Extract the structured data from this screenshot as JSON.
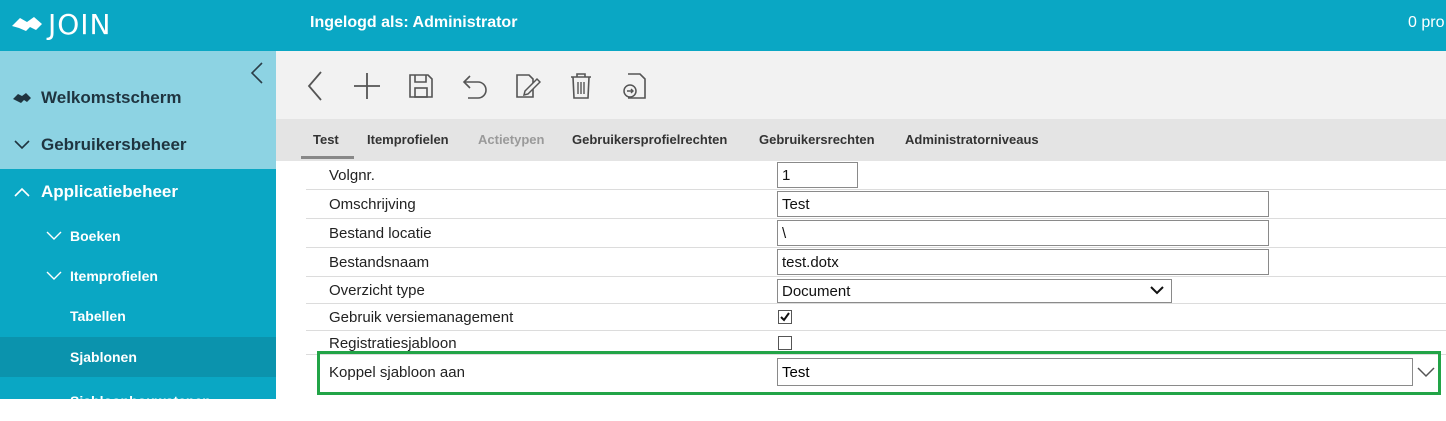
{
  "app": {
    "logo_text": "JOIN",
    "login_text": "Ingelogd als: Administrator",
    "top_right_text": "0 pro"
  },
  "sidebar": {
    "items": [
      {
        "label": "Welkomstscherm",
        "icon": "handshake-icon"
      },
      {
        "label": "Gebruikersbeheer",
        "icon": "chevron-down-icon"
      },
      {
        "label": "Applicatiebeheer",
        "icon": "chevron-up-icon"
      },
      {
        "label": "Boeken",
        "icon": "chevron-down-icon"
      },
      {
        "label": "Itemprofielen",
        "icon": "chevron-down-icon"
      },
      {
        "label": "Tabellen"
      },
      {
        "label": "Sjablonen",
        "active": true
      },
      {
        "label": "Sjabloonbouwstenen"
      }
    ],
    "colors": {
      "top": "#8dd3e3",
      "main": "#0aa7c4",
      "active": "#0b93ad"
    }
  },
  "toolbar": {
    "buttons": [
      "back-icon",
      "add-icon",
      "save-icon",
      "undo-icon",
      "edit-icon",
      "delete-icon",
      "export-icon"
    ]
  },
  "tabs": [
    {
      "label": "Test",
      "active": true
    },
    {
      "label": "Itemprofielen"
    },
    {
      "label": "Actietypen",
      "disabled": true
    },
    {
      "label": "Gebruikersprofielrechten"
    },
    {
      "label": "Gebruikersrechten"
    },
    {
      "label": "Administratorniveaus"
    }
  ],
  "form": {
    "volgnr": {
      "label": "Volgnr.",
      "value": "1"
    },
    "omschrijving": {
      "label": "Omschrijving",
      "value": "Test"
    },
    "bestand_locatie": {
      "label": "Bestand locatie",
      "value": "\\"
    },
    "bestandsnaam": {
      "label": "Bestandsnaam",
      "value": "test.dotx"
    },
    "overzicht_type": {
      "label": "Overzicht type",
      "value": "Document"
    },
    "versiemanagement": {
      "label": "Gebruik versiemanagement",
      "checked": true
    },
    "registratiesjabloon": {
      "label": "Registratiesjabloon",
      "checked": false
    },
    "koppel": {
      "label": "Koppel sjabloon aan",
      "value": "Test"
    }
  },
  "highlight_color": "#22a447"
}
